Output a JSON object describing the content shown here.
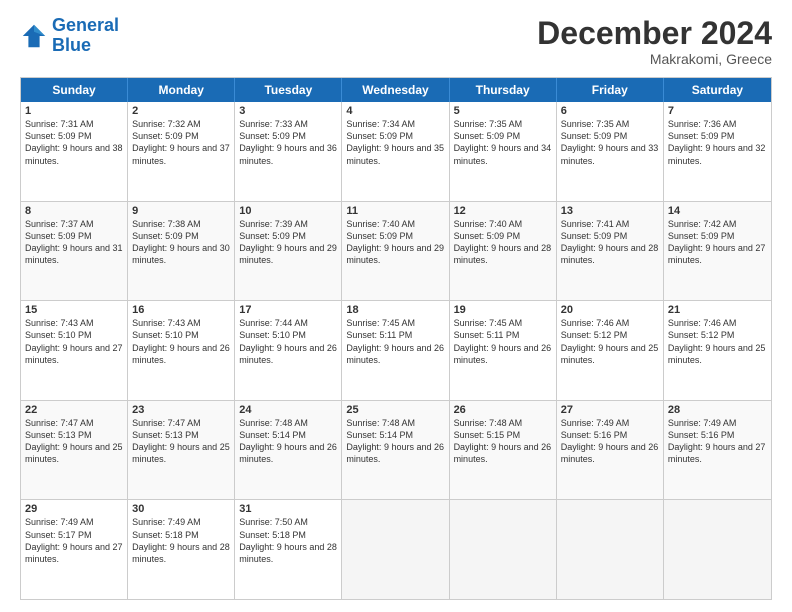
{
  "logo": {
    "line1": "General",
    "line2": "Blue"
  },
  "header": {
    "month": "December 2024",
    "location": "Makrakomi, Greece"
  },
  "days": [
    "Sunday",
    "Monday",
    "Tuesday",
    "Wednesday",
    "Thursday",
    "Friday",
    "Saturday"
  ],
  "weeks": [
    [
      {
        "day": "1",
        "rise": "Sunrise: 7:31 AM",
        "set": "Sunset: 5:09 PM",
        "daylight": "Daylight: 9 hours and 38 minutes."
      },
      {
        "day": "2",
        "rise": "Sunrise: 7:32 AM",
        "set": "Sunset: 5:09 PM",
        "daylight": "Daylight: 9 hours and 37 minutes."
      },
      {
        "day": "3",
        "rise": "Sunrise: 7:33 AM",
        "set": "Sunset: 5:09 PM",
        "daylight": "Daylight: 9 hours and 36 minutes."
      },
      {
        "day": "4",
        "rise": "Sunrise: 7:34 AM",
        "set": "Sunset: 5:09 PM",
        "daylight": "Daylight: 9 hours and 35 minutes."
      },
      {
        "day": "5",
        "rise": "Sunrise: 7:35 AM",
        "set": "Sunset: 5:09 PM",
        "daylight": "Daylight: 9 hours and 34 minutes."
      },
      {
        "day": "6",
        "rise": "Sunrise: 7:35 AM",
        "set": "Sunset: 5:09 PM",
        "daylight": "Daylight: 9 hours and 33 minutes."
      },
      {
        "day": "7",
        "rise": "Sunrise: 7:36 AM",
        "set": "Sunset: 5:09 PM",
        "daylight": "Daylight: 9 hours and 32 minutes."
      }
    ],
    [
      {
        "day": "8",
        "rise": "Sunrise: 7:37 AM",
        "set": "Sunset: 5:09 PM",
        "daylight": "Daylight: 9 hours and 31 minutes."
      },
      {
        "day": "9",
        "rise": "Sunrise: 7:38 AM",
        "set": "Sunset: 5:09 PM",
        "daylight": "Daylight: 9 hours and 30 minutes."
      },
      {
        "day": "10",
        "rise": "Sunrise: 7:39 AM",
        "set": "Sunset: 5:09 PM",
        "daylight": "Daylight: 9 hours and 29 minutes."
      },
      {
        "day": "11",
        "rise": "Sunrise: 7:40 AM",
        "set": "Sunset: 5:09 PM",
        "daylight": "Daylight: 9 hours and 29 minutes."
      },
      {
        "day": "12",
        "rise": "Sunrise: 7:40 AM",
        "set": "Sunset: 5:09 PM",
        "daylight": "Daylight: 9 hours and 28 minutes."
      },
      {
        "day": "13",
        "rise": "Sunrise: 7:41 AM",
        "set": "Sunset: 5:09 PM",
        "daylight": "Daylight: 9 hours and 28 minutes."
      },
      {
        "day": "14",
        "rise": "Sunrise: 7:42 AM",
        "set": "Sunset: 5:09 PM",
        "daylight": "Daylight: 9 hours and 27 minutes."
      }
    ],
    [
      {
        "day": "15",
        "rise": "Sunrise: 7:43 AM",
        "set": "Sunset: 5:10 PM",
        "daylight": "Daylight: 9 hours and 27 minutes."
      },
      {
        "day": "16",
        "rise": "Sunrise: 7:43 AM",
        "set": "Sunset: 5:10 PM",
        "daylight": "Daylight: 9 hours and 26 minutes."
      },
      {
        "day": "17",
        "rise": "Sunrise: 7:44 AM",
        "set": "Sunset: 5:10 PM",
        "daylight": "Daylight: 9 hours and 26 minutes."
      },
      {
        "day": "18",
        "rise": "Sunrise: 7:45 AM",
        "set": "Sunset: 5:11 PM",
        "daylight": "Daylight: 9 hours and 26 minutes."
      },
      {
        "day": "19",
        "rise": "Sunrise: 7:45 AM",
        "set": "Sunset: 5:11 PM",
        "daylight": "Daylight: 9 hours and 26 minutes."
      },
      {
        "day": "20",
        "rise": "Sunrise: 7:46 AM",
        "set": "Sunset: 5:12 PM",
        "daylight": "Daylight: 9 hours and 25 minutes."
      },
      {
        "day": "21",
        "rise": "Sunrise: 7:46 AM",
        "set": "Sunset: 5:12 PM",
        "daylight": "Daylight: 9 hours and 25 minutes."
      }
    ],
    [
      {
        "day": "22",
        "rise": "Sunrise: 7:47 AM",
        "set": "Sunset: 5:13 PM",
        "daylight": "Daylight: 9 hours and 25 minutes."
      },
      {
        "day": "23",
        "rise": "Sunrise: 7:47 AM",
        "set": "Sunset: 5:13 PM",
        "daylight": "Daylight: 9 hours and 25 minutes."
      },
      {
        "day": "24",
        "rise": "Sunrise: 7:48 AM",
        "set": "Sunset: 5:14 PM",
        "daylight": "Daylight: 9 hours and 26 minutes."
      },
      {
        "day": "25",
        "rise": "Sunrise: 7:48 AM",
        "set": "Sunset: 5:14 PM",
        "daylight": "Daylight: 9 hours and 26 minutes."
      },
      {
        "day": "26",
        "rise": "Sunrise: 7:48 AM",
        "set": "Sunset: 5:15 PM",
        "daylight": "Daylight: 9 hours and 26 minutes."
      },
      {
        "day": "27",
        "rise": "Sunrise: 7:49 AM",
        "set": "Sunset: 5:16 PM",
        "daylight": "Daylight: 9 hours and 26 minutes."
      },
      {
        "day": "28",
        "rise": "Sunrise: 7:49 AM",
        "set": "Sunset: 5:16 PM",
        "daylight": "Daylight: 9 hours and 27 minutes."
      }
    ],
    [
      {
        "day": "29",
        "rise": "Sunrise: 7:49 AM",
        "set": "Sunset: 5:17 PM",
        "daylight": "Daylight: 9 hours and 27 minutes."
      },
      {
        "day": "30",
        "rise": "Sunrise: 7:49 AM",
        "set": "Sunset: 5:18 PM",
        "daylight": "Daylight: 9 hours and 28 minutes."
      },
      {
        "day": "31",
        "rise": "Sunrise: 7:50 AM",
        "set": "Sunset: 5:18 PM",
        "daylight": "Daylight: 9 hours and 28 minutes."
      },
      null,
      null,
      null,
      null
    ]
  ]
}
